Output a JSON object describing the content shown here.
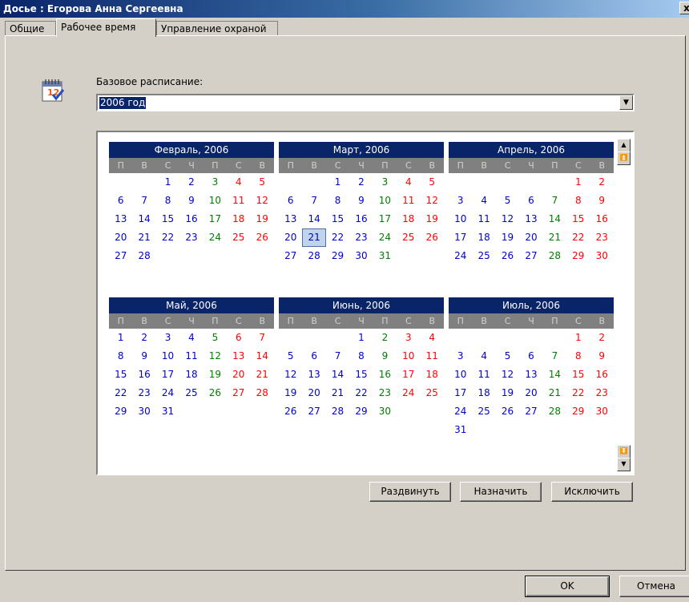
{
  "window": {
    "title": "Досье : Егорова Анна Сергеевна",
    "close_label": "x"
  },
  "tabs": [
    {
      "label": "Общие"
    },
    {
      "label": "Рабочее время"
    },
    {
      "label": "Управление охраной"
    }
  ],
  "schedule": {
    "label": "Базовое расписание:",
    "selected": "2006 год",
    "icon": "calendar-icon"
  },
  "weekday_headers": [
    "П",
    "В",
    "С",
    "Ч",
    "П",
    "С",
    "В"
  ],
  "months": [
    {
      "title": "Февраль, 2006",
      "offset": 2,
      "days": 28,
      "selected": null
    },
    {
      "title": "Март, 2006",
      "offset": 2,
      "days": 31,
      "selected": 21
    },
    {
      "title": "Апрель, 2006",
      "offset": 5,
      "days": 30,
      "selected": null
    },
    {
      "title": "Май, 2006",
      "offset": 0,
      "days": 31,
      "selected": null
    },
    {
      "title": "Июнь, 2006",
      "offset": 3,
      "days": 30,
      "selected": null
    },
    {
      "title": "Июль, 2006",
      "offset": 5,
      "days": 31,
      "selected": null
    }
  ],
  "colors": {
    "weekday": "#0000cc",
    "friday": "#008000",
    "weekend": "#ff0000",
    "header": "#0a246a"
  },
  "actions": {
    "spread": "Раздвинуть",
    "assign": "Назначить",
    "exclude": "Исключить"
  },
  "footer": {
    "ok": "OK",
    "cancel": "Отмена"
  }
}
